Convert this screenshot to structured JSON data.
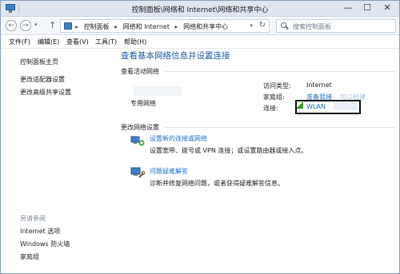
{
  "window": {
    "title": "控制面板\\网络和 Internet\\网络和共享中心",
    "min_glyph": "—",
    "max_glyph": "☐",
    "close_glyph": "✕"
  },
  "address": {
    "back_glyph": "←",
    "forward_glyph": "→",
    "dropdown_glyph": "▾",
    "up_glyph": "↑",
    "breadcrumbs": [
      "控制面板",
      "网络和 Internet",
      "网络和共享中心"
    ],
    "crumb_sep": "▸",
    "refresh_glyph": "↻",
    "search_placeholder": "搜索控制面板"
  },
  "menu": [
    "文件(F)",
    "编辑(E)",
    "查看(V)",
    "工具(T)",
    "帮助(H)"
  ],
  "sidebar": {
    "links": [
      "控制面板主页",
      "更改适配器设置",
      "更改高级共享设置"
    ],
    "see_also_caption": "另请参阅",
    "see_also": [
      "Internet 选项",
      "Windows 防火墙",
      "家庭组"
    ]
  },
  "main": {
    "title": "查看基本网络信息并设置连接",
    "active_networks_label": "查看活动网络",
    "network_type": "专用网络",
    "access_type_key": "访问类型:",
    "access_type_val": "Internet",
    "homegroup_key": "家庭组:",
    "homegroup_val": "准备就绪",
    "homegroup_val2": "可以创建",
    "connection_key": "连接:",
    "connection_val": "WLAN",
    "change_settings_label": "更改网络设置",
    "tasks": [
      {
        "title": "设置新的连接或网络",
        "desc": "设置宽带、拨号或 VPN 连接；或设置路由器或接入点。",
        "icon": "new-connection-icon"
      },
      {
        "title": "问题疑难解答",
        "desc": "诊断并修复网络问题，或者获得疑难解答信息。",
        "icon": "troubleshoot-icon"
      }
    ]
  },
  "colors": {
    "link": "#1e6fc6",
    "title": "#1a5aa6",
    "wifi": "#3f9a2f"
  }
}
